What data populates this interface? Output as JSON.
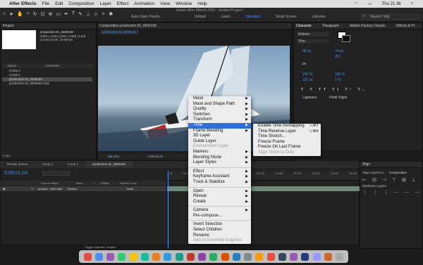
{
  "menubar": {
    "app": "After Effects",
    "items": [
      "File",
      "Edit",
      "Composition",
      "Layer",
      "Effect",
      "Animation",
      "View",
      "Window",
      "Help"
    ],
    "clock": "Thu 21:36"
  },
  "window": {
    "title": "Adobe After Effects 2020 - Untitled Project *"
  },
  "toolbar": {
    "snapping": "Auto-Open Panels",
    "workspaces": [
      {
        "label": "Default"
      },
      {
        "label": "Learn"
      },
      {
        "label": "Standard",
        "active": true
      },
      {
        "label": "Small Screen"
      },
      {
        "label": "Libraries"
      }
    ],
    "search_placeholder": "Search Help"
  },
  "project": {
    "title": "Project",
    "item_name": "production ID_4936160",
    "item_info": [
      "4096 x 2160 (1024 x 540) (1.00)",
      "Δ 0;00;12;00, 23.98 fps"
    ],
    "col_name": "Name",
    "col_comment": "Comment",
    "items": [
      {
        "label": "Comp 1"
      },
      {
        "label": "Comp 2"
      },
      {
        "label": "production ID_4936160",
        "selected": true
      },
      {
        "label": "production ID_4936160.mp4"
      }
    ],
    "bpc": "8 bpc"
  },
  "composition": {
    "panel_title": "Composition production ID_4936160",
    "tab": "production ID_4936160",
    "zoom": "(32.2%)",
    "timecode": "0;00;01;04"
  },
  "character": {
    "tabs": [
      "Character",
      "Paragraph",
      "Motion Factory Classic",
      "Effects & Pr"
    ],
    "font": "Roboto",
    "style": "Thin",
    "size": "88 px",
    "leading": "74 px",
    "tracking": "257",
    "stroke": "px",
    "vscale": "100 %",
    "hscale": "100 %",
    "baseline": "107 px",
    "tsume": "0 %",
    "ligatures": "Ligatures",
    "hindi": "Hindi Digits"
  },
  "align": {
    "title": "Align",
    "layers_to": "Align Layers to:",
    "target": "Composition",
    "distribute": "Distribute Layers:"
  },
  "timeline": {
    "tabs": [
      {
        "label": "Render Queue"
      },
      {
        "label": "Comp 1"
      },
      {
        "label": "Comp 2"
      },
      {
        "label": "production ID_4936160",
        "active": true
      }
    ],
    "timecode": "0;00;01;04",
    "columns": [
      "Source Name",
      "Mode",
      "T",
      "TrkMat",
      "Parent & Link"
    ],
    "layer": {
      "num": "1",
      "name": "product...6160.mp4",
      "mode": "Normal",
      "parent": "None"
    },
    "ruler": [
      "0f",
      "00:15f",
      "01:00f",
      "01:15f",
      "02:00f",
      "02:15f",
      "03:00f",
      "03:15f",
      "04:00f",
      "04:15f",
      "05:00f"
    ],
    "toggle_label": "Toggle Switches / Modes"
  },
  "context_menu": {
    "items": [
      {
        "label": "Mask",
        "arrow": true
      },
      {
        "label": "Mask and Shape Path",
        "arrow": true
      },
      {
        "label": "Quality",
        "arrow": true
      },
      {
        "label": "Switches",
        "arrow": true
      },
      {
        "label": "Transform",
        "arrow": true
      },
      {
        "label": "Time",
        "arrow": true,
        "highlighted": true
      },
      {
        "label": "Frame Blending",
        "arrow": true
      },
      {
        "label": "3D Layer"
      },
      {
        "label": "Guide Layer"
      },
      {
        "label": "Environment Layer",
        "disabled": true
      },
      {
        "label": "Markers",
        "arrow": true
      },
      {
        "label": "Blending Mode",
        "arrow": true
      },
      {
        "label": "Layer Styles",
        "arrow": true
      },
      {
        "sep": true
      },
      {
        "label": "Effect",
        "arrow": true
      },
      {
        "label": "Keyframe Assistant",
        "arrow": true
      },
      {
        "label": "Track & Stabilize",
        "arrow": true
      },
      {
        "sep": true
      },
      {
        "label": "Open",
        "arrow": true
      },
      {
        "label": "Reveal",
        "arrow": true
      },
      {
        "label": "Create",
        "arrow": true
      },
      {
        "sep": true
      },
      {
        "label": "Camera",
        "arrow": true
      },
      {
        "label": "Pre-compose..."
      },
      {
        "sep": true
      },
      {
        "label": "Invert Selection"
      },
      {
        "label": "Select Children"
      },
      {
        "label": "Rename"
      },
      {
        "label": "Add to Essential Graphics",
        "disabled": true
      }
    ]
  },
  "time_submenu": {
    "items": [
      {
        "label": "Enable Time Remapping",
        "shortcut": "⌥⌘T"
      },
      {
        "label": "Time-Reverse Layer",
        "shortcut": "⌥⌘R"
      },
      {
        "label": "Time Stretch..."
      },
      {
        "label": "Freeze Frame"
      },
      {
        "label": "Freeze On Last Frame"
      },
      {
        "label": "Align Video to Data",
        "disabled": true
      }
    ]
  },
  "dock": {
    "colors": [
      "#e44b3c",
      "#4f8ff0",
      "#9b59b6",
      "#2ecc71",
      "#f1c40f",
      "#1abc9c",
      "#e67e22",
      "#3498db",
      "#16a085",
      "#c0392b",
      "#8e44ad",
      "#27ae60",
      "#d35400",
      "#2980b9",
      "#7f8c8d",
      "#f39c12",
      "#e74c3c",
      "#34495e",
      "#9b59b6",
      "#1f3d7a",
      "#9999ff",
      "#cc6633",
      "#aaaaaa"
    ]
  }
}
